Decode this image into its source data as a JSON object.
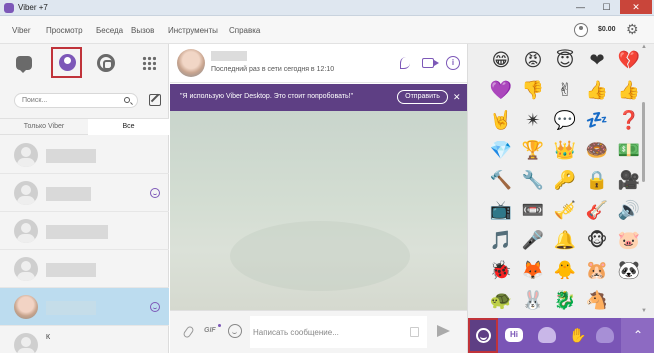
{
  "window": {
    "title": "Viber +7",
    "min": "—",
    "max": "☐",
    "close": "✕"
  },
  "menu": {
    "items": [
      "Viber",
      "Просмотр",
      "Беседа",
      "Вызов",
      "Инструменты",
      "Справка"
    ],
    "balance": "$0.00"
  },
  "sidebar": {
    "search_placeholder": "Поиск...",
    "filter_tabs": [
      "Только Viber",
      "Все"
    ],
    "last_row_text": "К"
  },
  "chat": {
    "status": "Последний раз в сети сегодня в 12:10",
    "promo_text": "\"Я использую Viber Desktop. Это стоит попробовать!\"",
    "promo_send": "Отправить",
    "promo_close": "✕",
    "gif_label": "GIF",
    "message_placeholder": "Написать сообщение...",
    "info_glyph": "i"
  },
  "stickers": {
    "items": [
      "😁",
      "😡",
      "😇",
      "❤",
      "💔",
      "💜",
      "👎",
      "✌",
      "👍",
      "👍",
      "🤘",
      "✴",
      "💬",
      "💤",
      "❓",
      "💎",
      "🏆",
      "👑",
      "🍩",
      "💵",
      "🔨",
      "🔧",
      "🔑",
      "🔒",
      "🎥",
      "📺",
      "📼",
      "🎺",
      "🎸",
      "🔊",
      "🎵",
      "🎤",
      "🔔",
      "🐵",
      "🐷",
      "🐞",
      "🦊",
      "🐥",
      "🐹",
      "🐼",
      "🐢",
      "🐰",
      "🐉",
      "🐴"
    ],
    "tab_hi": "Hi",
    "tab_up": "⌃",
    "tab_glyph_2": "✋"
  }
}
